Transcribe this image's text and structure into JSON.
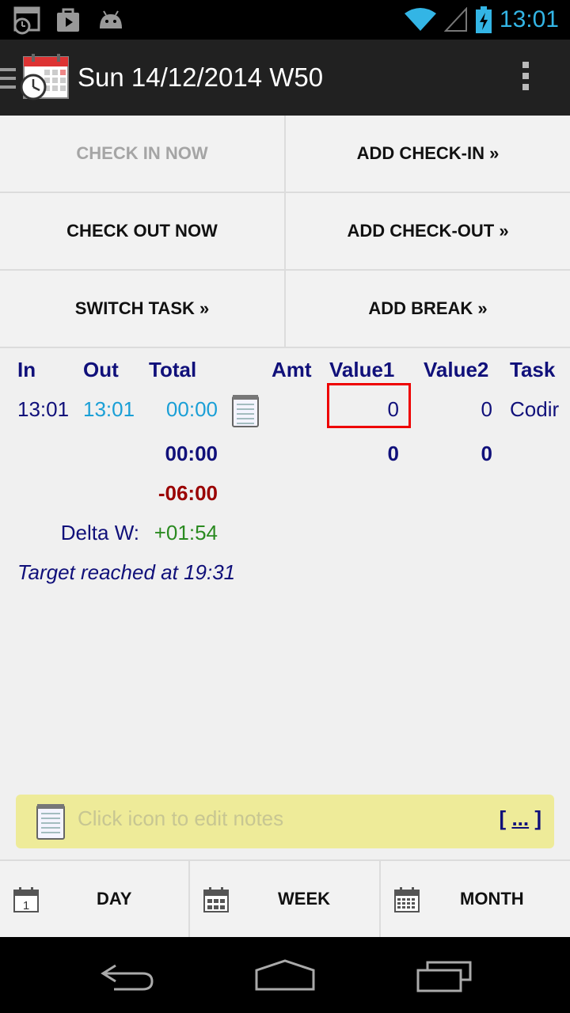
{
  "status_bar": {
    "time": "13:01"
  },
  "action_bar": {
    "title": "Sun 14/12/2014 W50"
  },
  "buttons": {
    "check_in_now": "CHECK IN NOW",
    "add_check_in": "ADD CHECK-IN »",
    "check_out_now": "CHECK OUT NOW",
    "add_check_out": "ADD CHECK-OUT »",
    "switch_task": "SWITCH TASK »",
    "add_break": "ADD BREAK »"
  },
  "table": {
    "headers": {
      "in": "In",
      "out": "Out",
      "total": "Total",
      "amt": "Amt",
      "value1": "Value1",
      "value2": "Value2",
      "task": "Task"
    },
    "row": {
      "in": "13:01",
      "out": "13:01",
      "total": "00:00",
      "value1": "0",
      "value2": "0",
      "task": "Codir"
    },
    "sum": {
      "total": "00:00",
      "value1": "0",
      "value2": "0"
    },
    "balance": "-06:00",
    "delta_label": "Delta W:",
    "delta_value": "+01:54",
    "target_text": "Target reached at 19:31"
  },
  "notes": {
    "placeholder": "Click icon to edit notes",
    "more_open": "[ ",
    "more_link": "...",
    "more_close": " ]"
  },
  "tabs": {
    "day": "DAY",
    "week": "WEEK",
    "month": "MONTH",
    "day_icon_num": "1"
  },
  "colors": {
    "header_text": "#10107a",
    "out_time": "#1a9fd6",
    "negative": "#9a0000",
    "positive": "#2a8a20",
    "notes_bg": "#eeeb99"
  }
}
